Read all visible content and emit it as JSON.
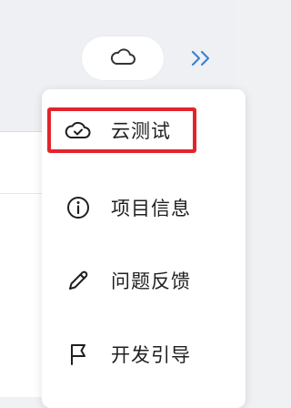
{
  "toolbar": {
    "cloud_button_icon": "cloud-icon",
    "collapse_icon": "double-chevron-right-icon"
  },
  "menu": {
    "items": [
      {
        "label": "云测试",
        "icon": "cloud-check-icon",
        "highlighted": true
      },
      {
        "label": "项目信息",
        "icon": "info-circle-icon",
        "highlighted": false
      },
      {
        "label": "问题反馈",
        "icon": "pencil-icon",
        "highlighted": false
      },
      {
        "label": "开发引导",
        "icon": "flag-icon",
        "highlighted": false
      }
    ]
  },
  "colors": {
    "highlight_border": "#e3242b",
    "accent_blue": "#3b82d6",
    "text": "#1f1f1f"
  }
}
